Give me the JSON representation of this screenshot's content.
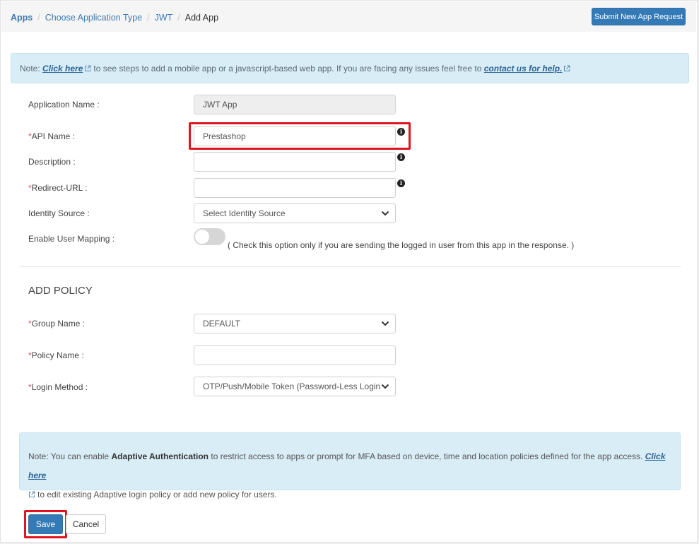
{
  "breadcrumb": {
    "items": [
      "Apps",
      "Choose Application Type",
      "JWT"
    ],
    "current": "Add App",
    "separator": "/"
  },
  "header": {
    "submit_button": "Submit New App Request"
  },
  "top_note": {
    "prefix": "Note:",
    "link1": "Click here",
    "middle": "to see steps to add a mobile app or a javascript-based web app. If you are facing any issues feel free to",
    "link2": "contact us for help."
  },
  "form": {
    "application_name": {
      "label": "Application Name :",
      "value": "JWT App"
    },
    "api_name": {
      "required": "*",
      "label": "API Name :",
      "value": "Prestashop"
    },
    "description": {
      "label": "Description :",
      "value": ""
    },
    "redirect_url": {
      "required": "*",
      "label": "Redirect-URL :",
      "value": ""
    },
    "identity_source": {
      "label": "Identity Source :",
      "selected": "Select Identity Source"
    },
    "user_mapping": {
      "label": "Enable User Mapping :",
      "enabled": false,
      "hint": "( Check this option only if you are sending the logged in user from this app in the response. )"
    }
  },
  "policy": {
    "title": "ADD POLICY",
    "group_name": {
      "required": "*",
      "label": "Group Name :",
      "selected": "DEFAULT"
    },
    "policy_name": {
      "required": "*",
      "label": "Policy Name :",
      "value": ""
    },
    "login_method": {
      "required": "*",
      "label": "Login Method :",
      "selected": "OTP/Push/Mobile Token (Password-Less Login)"
    }
  },
  "adaptive_note": {
    "prefix": "Note: You can enable",
    "bold": "Adaptive Authentication",
    "middle": "to restrict access to apps or prompt for MFA based on device, time and location policies defined for the app access.",
    "link": "Click here",
    "suffix": "to edit existing Adaptive login policy or add new policy for users."
  },
  "actions": {
    "save": "Save",
    "cancel": "Cancel"
  },
  "colors": {
    "primary": "#337ab7",
    "highlight": "#e0141e",
    "note_bg": "#d9edf7"
  }
}
